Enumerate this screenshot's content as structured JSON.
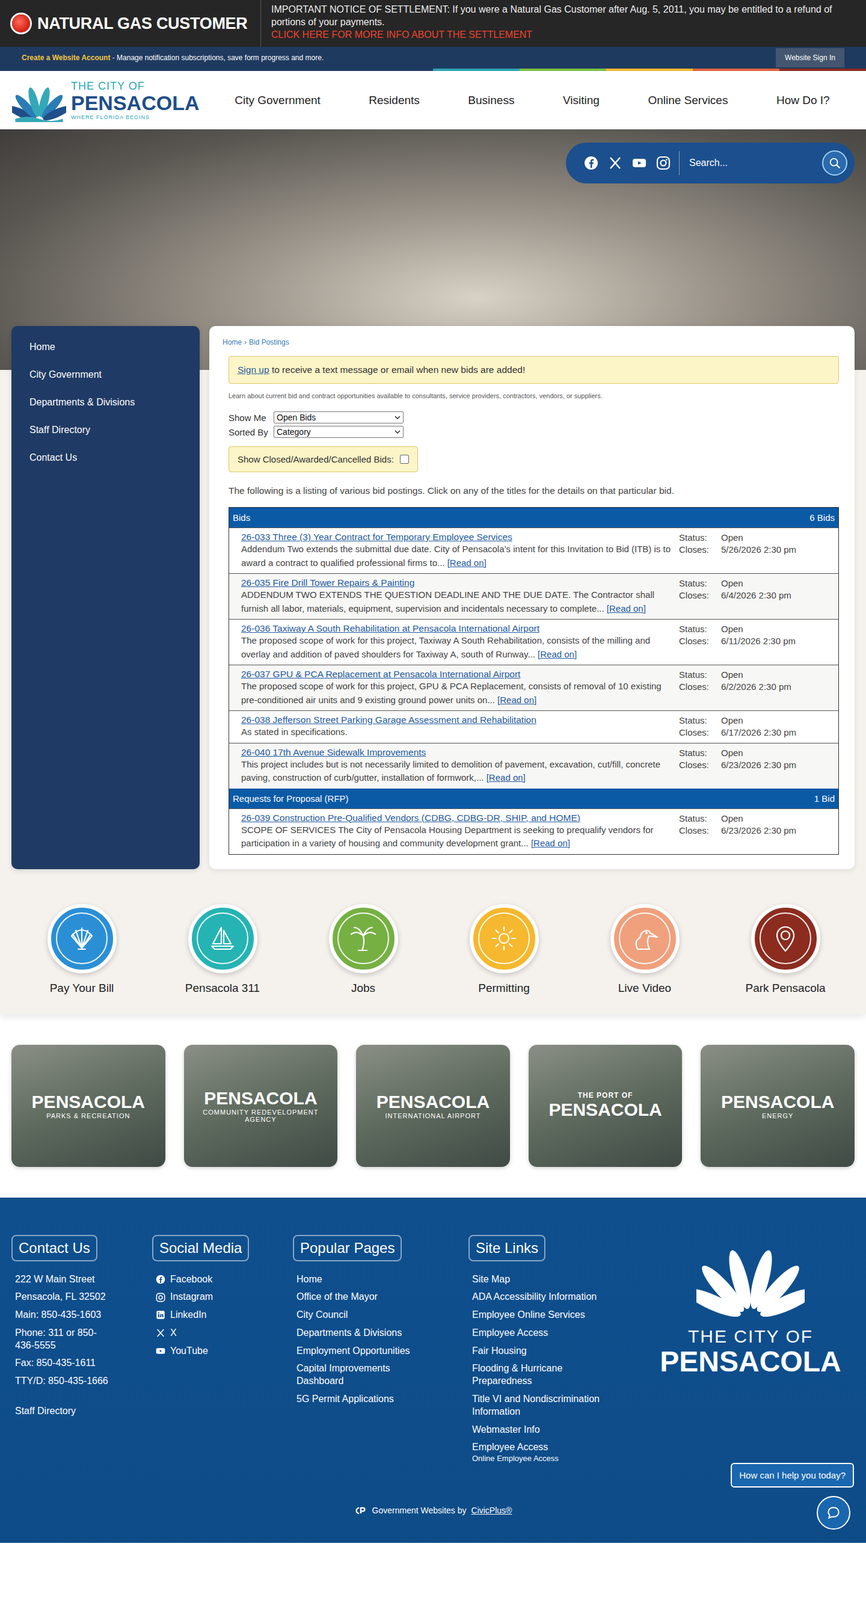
{
  "alert": {
    "title": "NATURAL GAS CUSTOMER",
    "notice": "IMPORTANT NOTICE OF SETTLEMENT: If you were a Natural Gas Customer after Aug. 5, 2011, you may be entitled to a refund of portions of your payments.",
    "link": "CLICK HERE FOR MORE INFO ABOUT THE SETTLEMENT"
  },
  "account_bar": {
    "link": "Create a Website Account",
    "text": "- Manage notification subscriptions, save form progress and more.",
    "sign_in": "Website Sign In"
  },
  "logo": {
    "top": "THE CITY OF",
    "name": "PENSACOLA",
    "tagline": "WHERE FLORIDA BEGINS"
  },
  "nav": [
    "City Government",
    "Residents",
    "Business",
    "Visiting",
    "Online Services",
    "How Do I?"
  ],
  "search": {
    "placeholder": "Search..."
  },
  "sidebar": {
    "items": [
      "Home",
      "City Government",
      "Departments & Divisions",
      "Staff Directory",
      "Contact Us"
    ]
  },
  "breadcrumb": {
    "items": [
      "Home",
      "Bid Postings"
    ],
    "separator": "›"
  },
  "signup": {
    "link": "Sign up",
    "text": "to receive a text message or email when new bids are added!"
  },
  "intro": "Learn about current bid and contract opportunities available to consultants, service providers, contractors, vendors, or suppliers.",
  "filters": {
    "show_me": {
      "label": "Show Me",
      "value": "Open Bids"
    },
    "sorted_by": {
      "label": "Sorted By",
      "value": "Category"
    },
    "show_closed": {
      "label": "Show Closed/Awarded/Cancelled Bids:",
      "checked": false
    }
  },
  "listing_intro": "The following is a listing of various bid postings. Click on any of the titles for the details on that particular bid.",
  "groups": [
    {
      "title": "Bids",
      "count": "6 Bids",
      "items": [
        {
          "title": "26-033 Three (3) Year Contract for Temporary Employee Services",
          "description": "Addendum Two extends the submittal due date. City of Pensacola’s intent for this Invitation to Bid (ITB) is to award a contract to qualified professional firms to...",
          "read_more": "[Read on]",
          "status_label": "Status:",
          "status": "Open",
          "closes_label": "Closes:",
          "closes": "5/26/2026 2:30 pm"
        },
        {
          "title": "26-035 Fire Drill Tower Repairs & Painting",
          "description": "ADDENDUM TWO EXTENDS THE QUESTION DEADLINE AND THE DUE DATE. The Contractor shall furnish all labor, materials, equipment, supervision and incidentals necessary to complete...",
          "read_more": "[Read on]",
          "status_label": "Status:",
          "status": "Open",
          "closes_label": "Closes:",
          "closes": "6/4/2026 2:30 pm"
        },
        {
          "title": "26-036 Taxiway A South Rehabilitation at Pensacola International Airport",
          "description": "The proposed scope of work for this project, Taxiway A South Rehabilitation, consists of the milling and overlay and addition of paved shoulders for Taxiway A, south of Runway...",
          "read_more": "[Read on]",
          "status_label": "Status:",
          "status": "Open",
          "closes_label": "Closes:",
          "closes": "6/11/2026 2:30 pm"
        },
        {
          "title": "26-037 GPU & PCA Replacement at Pensacola International Airport",
          "description": "The proposed scope of work for this project, GPU & PCA Replacement, consists of removal of 10 existing pre-conditioned air units and 9 existing ground power units on...",
          "read_more": "[Read on]",
          "status_label": "Status:",
          "status": "Open",
          "closes_label": "Closes:",
          "closes": "6/2/2026 2:30 pm"
        },
        {
          "title": "26-038 Jefferson Street Parking Garage Assessment and Rehabilitation",
          "description": "As stated in specifications.",
          "status_label": "Status:",
          "status": "Open",
          "closes_label": "Closes:",
          "closes": "6/17/2026 2:30 pm"
        },
        {
          "title": "26-040 17th Avenue Sidewalk Improvements",
          "description": "This project includes but is not necessarily limited to demolition of pavement, excavation, cut/fill, concrete paving, construction of curb/gutter, installation of formwork,...",
          "read_more": "[Read on]",
          "status_label": "Status:",
          "status": "Open",
          "closes_label": "Closes:",
          "closes": "6/23/2026 2:30 pm"
        }
      ]
    },
    {
      "title": "Requests for Proposal (RFP)",
      "count": "1 Bid",
      "items": [
        {
          "title": "26-039 Construction Pre-Qualified Vendors (CDBG, CDBG-DR, SHIP, and HOME)",
          "description": "SCOPE OF SERVICES The City of Pensacola Housing Department is seeking to prequalify vendors for participation in a variety of housing and community development grant...",
          "read_more": "[Read on]",
          "status_label": "Status:",
          "status": "Open",
          "closes_label": "Closes:",
          "closes": "6/23/2026 2:30 pm"
        }
      ]
    }
  ],
  "quick_links": [
    {
      "label": "Pay Your Bill",
      "color": "#2b8fd6"
    },
    {
      "label": "Pensacola 311",
      "color": "#26b3b3"
    },
    {
      "label": "Jobs",
      "color": "#76b043"
    },
    {
      "label": "Permitting",
      "color": "#f5b82e"
    },
    {
      "label": "Live Video",
      "color": "#f0a07c"
    },
    {
      "label": "Park Pensacola",
      "color": "#8b2c1f"
    }
  ],
  "image_cards": [
    {
      "name": "PENSACOLA",
      "sub": "PARKS & RECREATION"
    },
    {
      "name": "PENSACOLA",
      "sub": "COMMUNITY REDEVELOPMENT AGENCY"
    },
    {
      "name": "PENSACOLA",
      "sub": "INTERNATIONAL AIRPORT"
    },
    {
      "pre": "THE PORT OF",
      "name": "PENSACOLA"
    },
    {
      "name": "PENSACOLA",
      "sub": "ENERGY"
    }
  ],
  "footer": {
    "contact": {
      "title": "Contact Us",
      "lines": [
        "222 W Main Street",
        "Pensacola, FL 32502",
        "Main: 850-435-1603",
        "Phone: 311 or 850-436-5555",
        "Fax: 850-435-1611",
        "TTY/D: 850-435-1666"
      ],
      "staff": "Staff Directory"
    },
    "social": {
      "title": "Social Media",
      "items": [
        "Facebook",
        "Instagram",
        "LinkedIn",
        "X",
        "YouTube"
      ]
    },
    "popular": {
      "title": "Popular Pages",
      "items": [
        "Home",
        "Office of the Mayor",
        "City Council",
        "Departments & Divisions",
        "Employment Opportunities",
        "Capital Improvements Dashboard",
        "5G Permit Applications"
      ]
    },
    "site_links": {
      "title": "Site Links",
      "items": [
        {
          "label": "Site Map"
        },
        {
          "label": "ADA Accessibility Information"
        },
        {
          "label": "Employee Online Services"
        },
        {
          "label": "Employee Access"
        },
        {
          "label": "Fair Housing"
        },
        {
          "label": "Flooding & Hurricane Preparedness"
        },
        {
          "label": "Title VI and Nondiscrimination Information"
        },
        {
          "label": "Webmaster Info"
        },
        {
          "label": "Employee Access",
          "sub": "Online Employee Access"
        }
      ]
    },
    "logo": {
      "top": "THE CITY OF",
      "name": "PENSACOLA"
    }
  },
  "chat": {
    "prompt": "How can I help you today?"
  },
  "credits": {
    "text": "Government Websites by",
    "link": "CivicPlus®"
  }
}
